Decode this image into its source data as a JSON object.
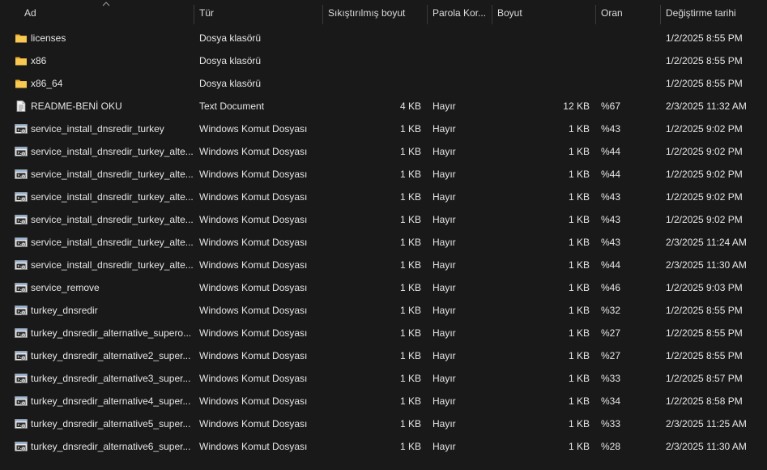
{
  "columns": {
    "name": "Ad",
    "type": "Tür",
    "compressed": "Sıkıştırılmış boyut",
    "password": "Parola Kor...",
    "size": "Boyut",
    "ratio": "Oran",
    "modified": "Değiştirme tarihi"
  },
  "sort": {
    "column": "name",
    "direction": "ascending"
  },
  "rows": [
    {
      "icon": "folder-icon",
      "name": "licenses",
      "type": "Dosya klasörü",
      "compressed": "",
      "password": "",
      "size": "",
      "ratio": "",
      "modified": "1/2/2025 8:55 PM"
    },
    {
      "icon": "folder-icon",
      "name": "x86",
      "type": "Dosya klasörü",
      "compressed": "",
      "password": "",
      "size": "",
      "ratio": "",
      "modified": "1/2/2025 8:55 PM"
    },
    {
      "icon": "folder-icon",
      "name": "x86_64",
      "type": "Dosya klasörü",
      "compressed": "",
      "password": "",
      "size": "",
      "ratio": "",
      "modified": "1/2/2025 8:55 PM"
    },
    {
      "icon": "text-document-icon",
      "name": "README-BENİ OKU",
      "type": "Text Document",
      "compressed": "4 KB",
      "password": "Hayır",
      "size": "12 KB",
      "ratio": "%67",
      "modified": "2/3/2025 11:32 AM"
    },
    {
      "icon": "batch-file-icon",
      "name": "service_install_dnsredir_turkey",
      "type": "Windows Komut Dosyası",
      "compressed": "1 KB",
      "password": "Hayır",
      "size": "1 KB",
      "ratio": "%43",
      "modified": "1/2/2025 9:02 PM"
    },
    {
      "icon": "batch-file-icon",
      "name": "service_install_dnsredir_turkey_alte...",
      "type": "Windows Komut Dosyası",
      "compressed": "1 KB",
      "password": "Hayır",
      "size": "1 KB",
      "ratio": "%44",
      "modified": "1/2/2025 9:02 PM"
    },
    {
      "icon": "batch-file-icon",
      "name": "service_install_dnsredir_turkey_alte...",
      "type": "Windows Komut Dosyası",
      "compressed": "1 KB",
      "password": "Hayır",
      "size": "1 KB",
      "ratio": "%44",
      "modified": "1/2/2025 9:02 PM"
    },
    {
      "icon": "batch-file-icon",
      "name": "service_install_dnsredir_turkey_alte...",
      "type": "Windows Komut Dosyası",
      "compressed": "1 KB",
      "password": "Hayır",
      "size": "1 KB",
      "ratio": "%43",
      "modified": "1/2/2025 9:02 PM"
    },
    {
      "icon": "batch-file-icon",
      "name": "service_install_dnsredir_turkey_alte...",
      "type": "Windows Komut Dosyası",
      "compressed": "1 KB",
      "password": "Hayır",
      "size": "1 KB",
      "ratio": "%43",
      "modified": "1/2/2025 9:02 PM"
    },
    {
      "icon": "batch-file-icon",
      "name": "service_install_dnsredir_turkey_alte...",
      "type": "Windows Komut Dosyası",
      "compressed": "1 KB",
      "password": "Hayır",
      "size": "1 KB",
      "ratio": "%43",
      "modified": "2/3/2025 11:24 AM"
    },
    {
      "icon": "batch-file-icon",
      "name": "service_install_dnsredir_turkey_alte...",
      "type": "Windows Komut Dosyası",
      "compressed": "1 KB",
      "password": "Hayır",
      "size": "1 KB",
      "ratio": "%44",
      "modified": "2/3/2025 11:30 AM"
    },
    {
      "icon": "batch-file-icon",
      "name": "service_remove",
      "type": "Windows Komut Dosyası",
      "compressed": "1 KB",
      "password": "Hayır",
      "size": "1 KB",
      "ratio": "%46",
      "modified": "1/2/2025 9:03 PM"
    },
    {
      "icon": "batch-file-icon",
      "name": "turkey_dnsredir",
      "type": "Windows Komut Dosyası",
      "compressed": "1 KB",
      "password": "Hayır",
      "size": "1 KB",
      "ratio": "%32",
      "modified": "1/2/2025 8:55 PM"
    },
    {
      "icon": "batch-file-icon",
      "name": "turkey_dnsredir_alternative_supero...",
      "type": "Windows Komut Dosyası",
      "compressed": "1 KB",
      "password": "Hayır",
      "size": "1 KB",
      "ratio": "%27",
      "modified": "1/2/2025 8:55 PM"
    },
    {
      "icon": "batch-file-icon",
      "name": "turkey_dnsredir_alternative2_super...",
      "type": "Windows Komut Dosyası",
      "compressed": "1 KB",
      "password": "Hayır",
      "size": "1 KB",
      "ratio": "%27",
      "modified": "1/2/2025 8:55 PM"
    },
    {
      "icon": "batch-file-icon",
      "name": "turkey_dnsredir_alternative3_super...",
      "type": "Windows Komut Dosyası",
      "compressed": "1 KB",
      "password": "Hayır",
      "size": "1 KB",
      "ratio": "%33",
      "modified": "1/2/2025 8:57 PM"
    },
    {
      "icon": "batch-file-icon",
      "name": "turkey_dnsredir_alternative4_super...",
      "type": "Windows Komut Dosyası",
      "compressed": "1 KB",
      "password": "Hayır",
      "size": "1 KB",
      "ratio": "%34",
      "modified": "1/2/2025 8:58 PM"
    },
    {
      "icon": "batch-file-icon",
      "name": "turkey_dnsredir_alternative5_super...",
      "type": "Windows Komut Dosyası",
      "compressed": "1 KB",
      "password": "Hayır",
      "size": "1 KB",
      "ratio": "%33",
      "modified": "2/3/2025 11:25 AM"
    },
    {
      "icon": "batch-file-icon",
      "name": "turkey_dnsredir_alternative6_super...",
      "type": "Windows Komut Dosyası",
      "compressed": "1 KB",
      "password": "Hayır",
      "size": "1 KB",
      "ratio": "%28",
      "modified": "2/3/2025 11:30 AM"
    }
  ],
  "colors": {
    "background": "#191919",
    "text": "#e6e6e6",
    "separator": "#3a3a3a",
    "folder": "#f2c14e"
  }
}
